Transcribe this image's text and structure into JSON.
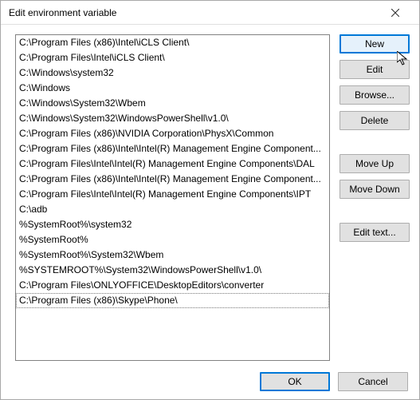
{
  "titlebar": {
    "title": "Edit environment variable"
  },
  "list": {
    "items": [
      "C:\\Program Files (x86)\\Intel\\iCLS Client\\",
      "C:\\Program Files\\Intel\\iCLS Client\\",
      "C:\\Windows\\system32",
      "C:\\Windows",
      "C:\\Windows\\System32\\Wbem",
      "C:\\Windows\\System32\\WindowsPowerShell\\v1.0\\",
      "C:\\Program Files (x86)\\NVIDIA Corporation\\PhysX\\Common",
      "C:\\Program Files (x86)\\Intel\\Intel(R) Management Engine Component...",
      "C:\\Program Files\\Intel\\Intel(R) Management Engine Components\\DAL",
      "C:\\Program Files (x86)\\Intel\\Intel(R) Management Engine Component...",
      "C:\\Program Files\\Intel\\Intel(R) Management Engine Components\\IPT",
      "C:\\adb",
      "%SystemRoot%\\system32",
      "%SystemRoot%",
      "%SystemRoot%\\System32\\Wbem",
      "%SYSTEMROOT%\\System32\\WindowsPowerShell\\v1.0\\",
      "C:\\Program Files\\ONLYOFFICE\\DesktopEditors\\converter",
      "C:\\Program Files (x86)\\Skype\\Phone\\"
    ],
    "selected_index": 17
  },
  "buttons": {
    "new": "New",
    "edit": "Edit",
    "browse": "Browse...",
    "delete": "Delete",
    "move_up": "Move Up",
    "move_down": "Move Down",
    "edit_text": "Edit text...",
    "ok": "OK",
    "cancel": "Cancel"
  }
}
